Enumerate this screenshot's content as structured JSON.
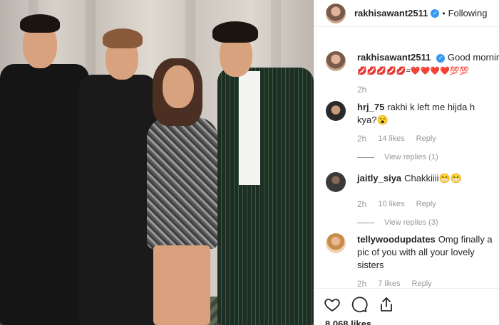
{
  "post": {
    "author": "rakhisawant2511",
    "follow_state": "Following",
    "caption_author": "rakhisawant2511",
    "caption_text": "Good morning",
    "caption_emojis": "💋💋💋💋💋=❤️❤️❤️❤️💯💯",
    "caption_time": "2h",
    "likes": "8,068 likes"
  },
  "comments": [
    {
      "user": "hrj_75",
      "text": "rakhi k left me hijda h kya?😮",
      "time": "2h",
      "likes": "14 likes",
      "reply": "Reply",
      "view_replies": "View replies (1)"
    },
    {
      "user": "jaitly_siya",
      "text": "Chakkiiii😁😁",
      "time": "2h",
      "likes": "10 likes",
      "reply": "Reply",
      "view_replies": "View replies (3)"
    },
    {
      "user": "tellywoodupdates",
      "text": "Omg finally a pic of you with all your lovely sisters",
      "time": "2h",
      "likes": "7 likes",
      "reply": "Reply"
    }
  ],
  "icons": {
    "like": "heart-icon",
    "comment": "comment-icon",
    "share": "share-icon",
    "verified": "verified-badge-icon"
  },
  "colors": {
    "verified": "#3897f0",
    "meta_text": "#999999",
    "text": "#262626"
  }
}
